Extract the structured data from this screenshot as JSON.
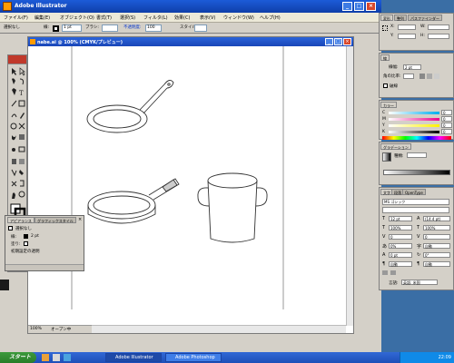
{
  "app": {
    "title": "Adobe Illustrator",
    "menus": [
      "ファイル(F)",
      "編集(E)",
      "オブジェクト(O)",
      "書式(T)",
      "選択(S)",
      "フィルタ(L)",
      "効果(C)",
      "表示(V)",
      "ウィンドウ(W)",
      "ヘルプ(H)"
    ]
  },
  "control_bar": {
    "selection": "選択なし",
    "stroke_label": "線:",
    "stroke_width": "1 pt",
    "brush_label": "ブラシ:",
    "opacity_label": "不透明度:",
    "opacity_value": "100",
    "style_label": "スタイル:"
  },
  "document": {
    "tab_title": "nabe.ai @ 100% (CMYK/プレビュー)",
    "zoom": "100%",
    "status": "オープン中"
  },
  "appearance_panel": {
    "tabs": [
      "アピアランス",
      "グラフィックスタイル"
    ],
    "selection": "選択なし",
    "stroke_label": "線:",
    "stroke_value": "2 pt",
    "fill_label": "塗り:",
    "opacity_label": "初期設定の透明"
  },
  "transform_panel": {
    "tabs": [
      "変形",
      "整列",
      "パスファインダー"
    ],
    "x_label": "X:",
    "y_label": "Y:",
    "w_label": "W:",
    "h_label": "H:"
  },
  "stroke_panel": {
    "title": "線",
    "weight_label": "線幅:",
    "weight_value": "2 pt",
    "miter_label": "角の比率:",
    "dashed_label": "破線"
  },
  "color_panel": {
    "title": "カラー",
    "channels": [
      "C",
      "M",
      "Y",
      "K"
    ],
    "values": [
      "0",
      "0",
      "0",
      "0"
    ]
  },
  "gradient_panel": {
    "title": "グラデーション",
    "type_label": "種類:"
  },
  "character_panel": {
    "tabs": [
      "文字",
      "段落",
      "OpenType"
    ],
    "font": "MS ゴシック",
    "size": "12 pt",
    "leading": "(14.4 pt)",
    "scale_h": "100%",
    "scale_v": "100%",
    "tracking": "0",
    "kerning": "自動",
    "percent": "0%",
    "baseline": "0 pt",
    "rotation": "0°",
    "auto1": "自動",
    "auto2": "自動",
    "language_label": "言語:",
    "language": "英語: 米国"
  },
  "taskbar": {
    "start": "スタート",
    "tasks": [
      "Adobe Illustrator",
      "Adobe Photoshop"
    ],
    "clock": "22:09"
  },
  "colors": {
    "desktop": "#3a6ea5",
    "titlebar": "#1c5bd8",
    "taskbar": "#3168d5",
    "start": "#3c9a3c"
  }
}
